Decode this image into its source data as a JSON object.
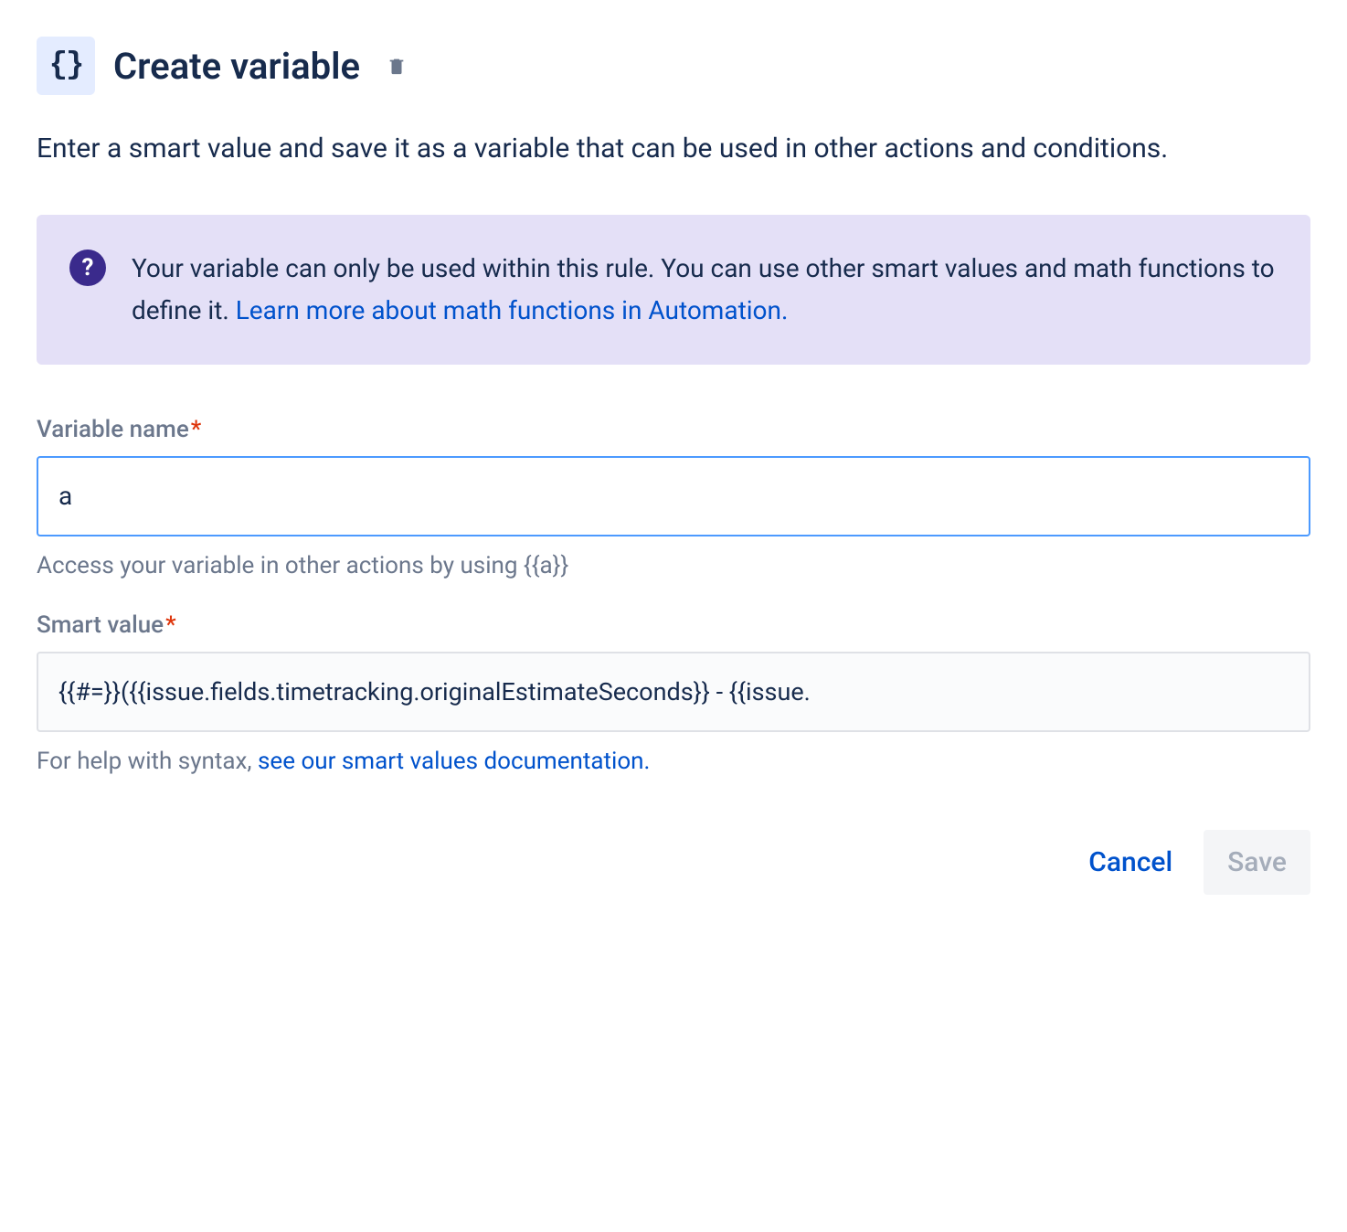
{
  "header": {
    "icon_text": "{}",
    "title": "Create variable"
  },
  "description": "Enter a smart value and save it as a variable that can be used in other actions and conditions.",
  "info_panel": {
    "icon_text": "?",
    "text_part1": "Your variable can only be used within this rule. You can use other smart values and math functions to define it. ",
    "link_text": "Learn more about math functions in Automation."
  },
  "fields": {
    "variable_name": {
      "label": "Variable name",
      "required_mark": "*",
      "value": "a",
      "helper": "Access your variable in other actions by using {{a}}"
    },
    "smart_value": {
      "label": "Smart value",
      "required_mark": "*",
      "value": "{{#=}}({{issue.fields.timetracking.originalEstimateSeconds}} - {{issue.",
      "helper_prefix": "For help with syntax, ",
      "helper_link": "see our smart values documentation."
    }
  },
  "buttons": {
    "cancel": "Cancel",
    "save": "Save"
  }
}
